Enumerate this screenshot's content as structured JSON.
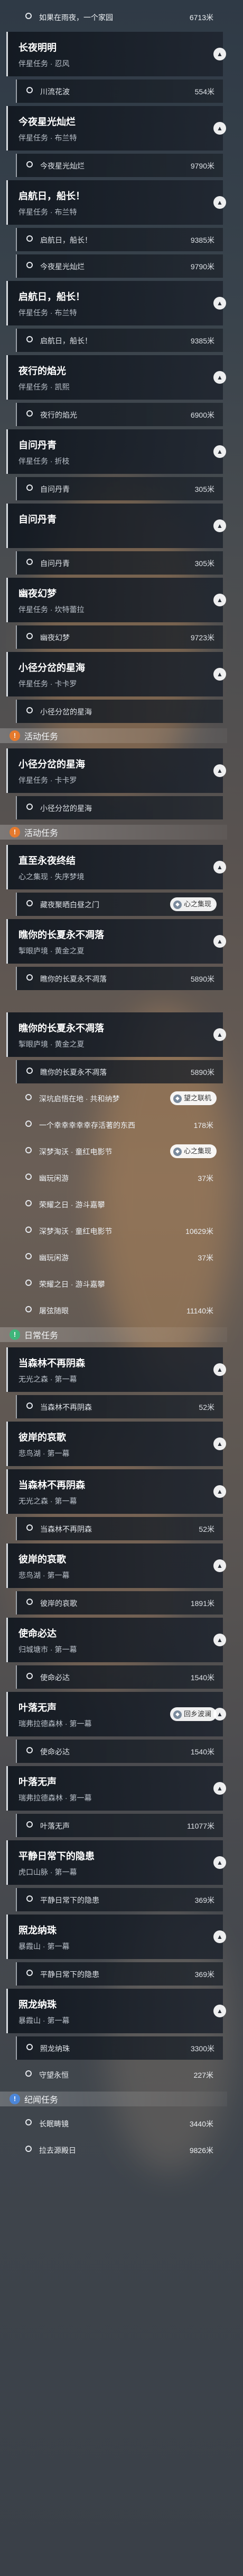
{
  "colors": {
    "story": "#e05a2a",
    "event": "#e57a2e",
    "daily": "#3fb57a",
    "cycle": "#4c86d8"
  },
  "items": [
    {
      "kind": "plain",
      "text": "如果在雨夜，一个家园",
      "dist": "6713米"
    },
    {
      "kind": "card",
      "title": "长夜明明",
      "sub": "伴星任务 · 忍风"
    },
    {
      "kind": "item",
      "text": "川流花波",
      "dist": "554米"
    },
    {
      "kind": "card",
      "title": "今夜星光灿烂",
      "sub": "伴星任务 · 布兰特"
    },
    {
      "kind": "item",
      "text": "今夜星光灿烂",
      "dist": "9790米"
    },
    {
      "kind": "card",
      "title": "启航日，船长！",
      "sub": "伴星任务 · 布兰特"
    },
    {
      "kind": "item",
      "text": "启航日，船长！",
      "dist": "9385米"
    },
    {
      "kind": "item",
      "text": "今夜星光灿烂",
      "dist": "9790米"
    },
    {
      "kind": "card",
      "title": "启航日，船长！",
      "sub": "伴星任务 · 布兰特"
    },
    {
      "kind": "item",
      "text": "启航日，船长！",
      "dist": "9385米"
    },
    {
      "kind": "card",
      "title": "夜行的焰光",
      "sub": "伴星任务 · 凯熙"
    },
    {
      "kind": "item",
      "text": "夜行的焰光",
      "dist": "6900米"
    },
    {
      "kind": "card",
      "title": "自问丹青",
      "sub": "伴星任务 · 折枝"
    },
    {
      "kind": "item",
      "text": "自问丹青",
      "dist": "305米"
    },
    {
      "kind": "card",
      "title": "自问丹青",
      "sub": ""
    },
    {
      "kind": "item",
      "text": "自问丹青",
      "dist": "305米"
    },
    {
      "kind": "card",
      "title": "幽夜幻梦",
      "sub": "伴星任务 · 坎特蕾拉"
    },
    {
      "kind": "item",
      "text": "幽夜幻梦",
      "dist": "9723米"
    },
    {
      "kind": "card",
      "title": "小径分岔的星海",
      "sub": "伴星任务 · 卡卡罗"
    },
    {
      "kind": "item",
      "text": "小径分岔的星海",
      "dist": ""
    },
    {
      "kind": "section",
      "label": "活动任务",
      "color": "event"
    },
    {
      "kind": "card",
      "title": "小径分岔的星海",
      "sub": "伴星任务 · 卡卡罗"
    },
    {
      "kind": "item",
      "text": "小径分岔的星海",
      "dist": ""
    },
    {
      "kind": "section",
      "label": "活动任务",
      "color": "event"
    },
    {
      "kind": "card",
      "title": "直至永夜终结",
      "sub": "心之集现 · 失序梦境"
    },
    {
      "kind": "item",
      "text": "藏夜聚晒白昼之门",
      "dist": "1852米",
      "tag": "心之集现"
    },
    {
      "kind": "card",
      "title": "瞧你的长夏永不凋落",
      "sub": "掣眼庐境 · 黄金之夏"
    },
    {
      "kind": "item",
      "text": "瞧你的长夏永不凋落",
      "dist": "5890米"
    },
    {
      "kind": "tag",
      "text": ""
    },
    {
      "kind": "card",
      "title": "瞧你的长夏永不凋落",
      "sub": "掣眼庐境 · 黄金之夏"
    },
    {
      "kind": "item",
      "text": "瞧你的长夏永不凋落",
      "dist": "5890米"
    },
    {
      "kind": "plain",
      "text": "深坑启悟在地 · 共和纳梦",
      "dist": "",
      "tag": "望之联机"
    },
    {
      "kind": "plain",
      "text": "一个幸幸幸幸幸存活著的东西",
      "dist": "178米"
    },
    {
      "kind": "plain",
      "text": "深梦淘沃 · 童红电影节",
      "dist": "10629米",
      "tag": "心之集现"
    },
    {
      "kind": "plain",
      "text": "幽玩闲游",
      "dist": "37米"
    },
    {
      "kind": "plain",
      "text": "荣耀之日 · 游斗嘉攀",
      "dist": ""
    },
    {
      "kind": "plain",
      "text": "深梦淘沃 · 童红电影节",
      "dist": "10629米"
    },
    {
      "kind": "plain",
      "text": "幽玩闲游",
      "dist": "37米"
    },
    {
      "kind": "plain",
      "text": "荣耀之日 · 游斗嘉攀",
      "dist": ""
    },
    {
      "kind": "plain",
      "text": "屠弦随眼",
      "dist": "11140米"
    },
    {
      "kind": "section",
      "label": "日常任务",
      "color": "daily"
    },
    {
      "kind": "card",
      "title": "当森林不再阴森",
      "sub": "无光之森 · 第一幕"
    },
    {
      "kind": "item",
      "text": "当森林不再阴森",
      "dist": "52米"
    },
    {
      "kind": "card",
      "title": "彼岸的哀歌",
      "sub": "悲鸟湖 · 第一幕"
    },
    {
      "kind": "card",
      "title": "当森林不再阴森",
      "sub": "无光之森 · 第一幕"
    },
    {
      "kind": "item",
      "text": "当森林不再阴森",
      "dist": "52米"
    },
    {
      "kind": "card",
      "title": "彼岸的哀歌",
      "sub": "悲鸟湖 · 第一幕"
    },
    {
      "kind": "item",
      "text": "彼岸的哀歌",
      "dist": "1891米"
    },
    {
      "kind": "card",
      "title": "使命必达",
      "sub": "归城塘市 · 第一幕"
    },
    {
      "kind": "item",
      "text": "使命必达",
      "dist": "1540米"
    },
    {
      "kind": "card",
      "title": "叶落无声",
      "sub": "瑞弗拉德森林 · 第一幕",
      "tag": "回乡波澜"
    },
    {
      "kind": "item",
      "text": "使命必达",
      "dist": "1540米"
    },
    {
      "kind": "card",
      "title": "叶落无声",
      "sub": "瑞弗拉德森林 · 第一幕"
    },
    {
      "kind": "item",
      "text": "叶落无声",
      "dist": "11077米"
    },
    {
      "kind": "card",
      "title": "平静日常下的隐患",
      "sub": "虎口山脉 · 第一幕"
    },
    {
      "kind": "item",
      "text": "平静日常下的隐患",
      "dist": "369米"
    },
    {
      "kind": "card",
      "title": "照龙纳珠",
      "sub": "暴霞山 · 第一幕"
    },
    {
      "kind": "item",
      "text": "平静日常下的隐患",
      "dist": "369米"
    },
    {
      "kind": "card",
      "title": "照龙纳珠",
      "sub": "暴霞山 · 第一幕"
    },
    {
      "kind": "item",
      "text": "照龙纳珠",
      "dist": "3300米"
    },
    {
      "kind": "plain",
      "text": "守望永恒",
      "dist": "227米"
    },
    {
      "kind": "section",
      "label": "纪闻任务",
      "color": "cycle"
    },
    {
      "kind": "plain",
      "text": "长眠畴镜",
      "dist": "3440米"
    },
    {
      "kind": "plain",
      "text": "拉去源殿日",
      "dist": "9826米"
    }
  ]
}
